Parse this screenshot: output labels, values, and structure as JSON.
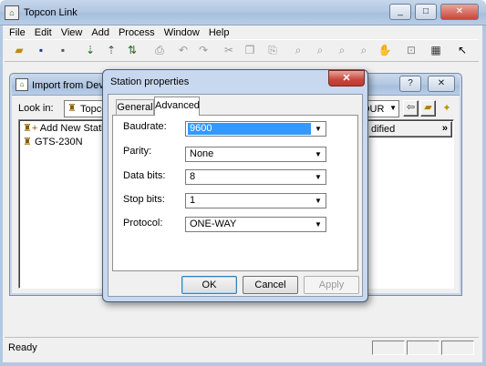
{
  "app": {
    "title": "Topcon Link",
    "status": "Ready",
    "menu": [
      "File",
      "Edit",
      "View",
      "Add",
      "Process",
      "Window",
      "Help"
    ],
    "toolbar_icons": [
      "open-icon",
      "save-icon",
      "save-all-icon",
      "import-icon",
      "export-icon",
      "compute-icon",
      "print-icon",
      "undo-icon",
      "redo-icon",
      "cut-icon",
      "copy-icon",
      "paste-icon",
      "zoom-icon",
      "zoom-in-icon",
      "zoom-out-icon",
      "zoom-window-icon",
      "pan-icon",
      "fit-icon",
      "table-icon",
      "help-pointer-icon"
    ]
  },
  "import_window": {
    "title": "Import from Devi",
    "look_in_label": "Look in:",
    "look_in_value": "Topco",
    "right_value": "OUR",
    "modified_header": "dified",
    "more": "»",
    "tree": [
      "Add New Station",
      "GTS-230N"
    ]
  },
  "dialog": {
    "title": "Station properties",
    "tabs": [
      "General",
      "Advanced"
    ],
    "active_tab": "Advanced",
    "fields": [
      {
        "label": "Baudrate:",
        "value": "9600"
      },
      {
        "label": "Parity:",
        "value": "None"
      },
      {
        "label": "Data bits:",
        "value": "8"
      },
      {
        "label": "Stop bits:",
        "value": "1"
      },
      {
        "label": "Protocol:",
        "value": "ONE-WAY"
      }
    ],
    "buttons": {
      "ok": "OK",
      "cancel": "Cancel",
      "apply": "Apply"
    }
  },
  "colors": {
    "selection": "#3399ff",
    "close_red": "#c8453b",
    "titlebar": "#b3c8e2"
  }
}
